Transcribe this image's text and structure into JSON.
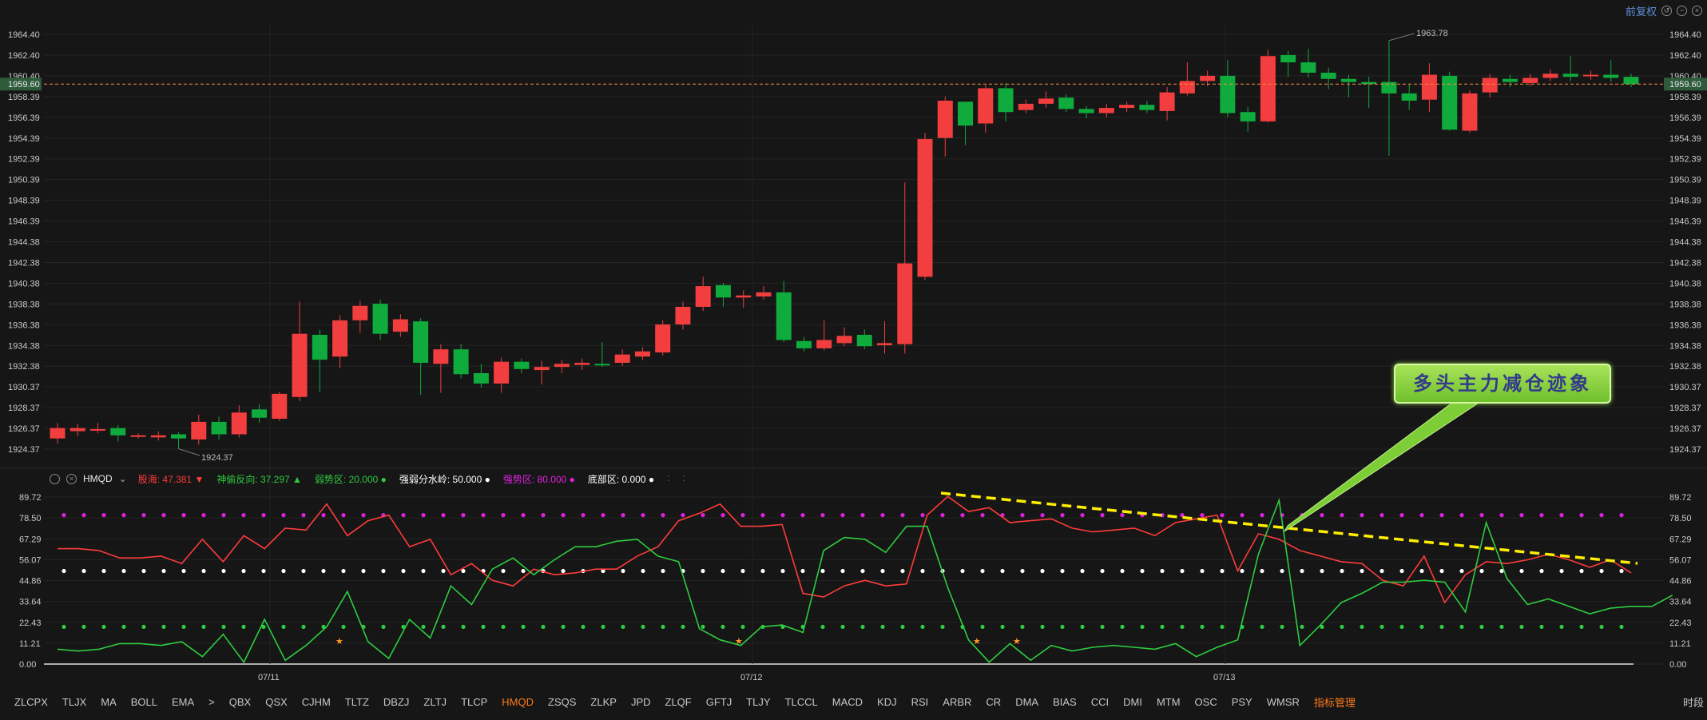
{
  "top_right": {
    "label": "前复权"
  },
  "main_chart": {
    "y_ticks": [
      "1964.40",
      "1962.40",
      "1960.40",
      "1958.39",
      "1956.39",
      "1954.39",
      "1952.39",
      "1950.39",
      "1948.39",
      "1946.39",
      "1944.38",
      "1942.38",
      "1940.38",
      "1938.38",
      "1936.38",
      "1934.38",
      "1932.38",
      "1930.37",
      "1928.37",
      "1926.37",
      "1924.37"
    ],
    "current_price": "1959.60",
    "max_label": "1963.78",
    "min_label": "1924.37"
  },
  "chart_data": [
    {
      "type": "candlestick",
      "title": "",
      "ylim": [
        1922.8,
        1965.6
      ],
      "x_labels": [
        "07/11",
        "07/12",
        "07/13"
      ],
      "candles": [
        {
          "o": 1925.4,
          "c": 1926.4,
          "h": 1926.9,
          "l": 1924.9
        },
        {
          "o": 1926.1,
          "c": 1926.4,
          "h": 1926.8,
          "l": 1925.6
        },
        {
          "o": 1926.2,
          "c": 1926.3,
          "h": 1926.9,
          "l": 1925.9
        },
        {
          "o": 1926.4,
          "c": 1925.7,
          "h": 1926.7,
          "l": 1925.1
        },
        {
          "o": 1925.6,
          "c": 1925.7,
          "h": 1925.9,
          "l": 1925.4
        },
        {
          "o": 1925.5,
          "c": 1925.7,
          "h": 1926.1,
          "l": 1925.2
        },
        {
          "o": 1925.8,
          "c": 1925.4,
          "h": 1926.0,
          "l": 1924.4
        },
        {
          "o": 1925.3,
          "c": 1927.0,
          "h": 1927.7,
          "l": 1924.8
        },
        {
          "o": 1927.0,
          "c": 1925.8,
          "h": 1927.5,
          "l": 1925.3
        },
        {
          "o": 1925.8,
          "c": 1927.9,
          "h": 1928.6,
          "l": 1925.5
        },
        {
          "o": 1928.2,
          "c": 1927.4,
          "h": 1928.7,
          "l": 1926.9
        },
        {
          "o": 1927.3,
          "c": 1929.7,
          "h": 1929.9,
          "l": 1927.1
        },
        {
          "o": 1929.4,
          "c": 1935.5,
          "h": 1938.6,
          "l": 1929.0
        },
        {
          "o": 1935.4,
          "c": 1933.0,
          "h": 1935.9,
          "l": 1929.9
        },
        {
          "o": 1933.3,
          "c": 1936.8,
          "h": 1937.3,
          "l": 1932.2
        },
        {
          "o": 1936.8,
          "c": 1938.2,
          "h": 1938.7,
          "l": 1935.6
        },
        {
          "o": 1938.4,
          "c": 1935.5,
          "h": 1938.8,
          "l": 1934.9
        },
        {
          "o": 1935.7,
          "c": 1936.9,
          "h": 1937.4,
          "l": 1935.2
        },
        {
          "o": 1936.7,
          "c": 1932.7,
          "h": 1937.0,
          "l": 1929.6
        },
        {
          "o": 1932.6,
          "c": 1934.0,
          "h": 1934.5,
          "l": 1929.8
        },
        {
          "o": 1934.0,
          "c": 1931.6,
          "h": 1934.5,
          "l": 1931.2
        },
        {
          "o": 1931.7,
          "c": 1930.7,
          "h": 1932.6,
          "l": 1930.3
        },
        {
          "o": 1930.7,
          "c": 1932.8,
          "h": 1933.2,
          "l": 1929.8
        },
        {
          "o": 1932.8,
          "c": 1932.1,
          "h": 1933.1,
          "l": 1931.7
        },
        {
          "o": 1932.0,
          "c": 1932.3,
          "h": 1932.9,
          "l": 1930.6
        },
        {
          "o": 1932.3,
          "c": 1932.6,
          "h": 1933.0,
          "l": 1931.7
        },
        {
          "o": 1932.5,
          "c": 1932.7,
          "h": 1933.1,
          "l": 1932.0
        },
        {
          "o": 1932.6,
          "c": 1932.5,
          "h": 1934.7,
          "l": 1932.3
        },
        {
          "o": 1932.7,
          "c": 1933.5,
          "h": 1934.0,
          "l": 1932.4
        },
        {
          "o": 1933.3,
          "c": 1933.8,
          "h": 1934.2,
          "l": 1933.0
        },
        {
          "o": 1933.7,
          "c": 1936.4,
          "h": 1936.8,
          "l": 1933.4
        },
        {
          "o": 1936.4,
          "c": 1938.1,
          "h": 1938.6,
          "l": 1935.9
        },
        {
          "o": 1938.1,
          "c": 1940.1,
          "h": 1941.0,
          "l": 1937.7
        },
        {
          "o": 1940.2,
          "c": 1939.0,
          "h": 1940.4,
          "l": 1938.1
        },
        {
          "o": 1939.0,
          "c": 1939.2,
          "h": 1939.7,
          "l": 1938.0
        },
        {
          "o": 1939.1,
          "c": 1939.5,
          "h": 1940.1,
          "l": 1938.8
        },
        {
          "o": 1939.5,
          "c": 1934.9,
          "h": 1940.6,
          "l": 1934.7
        },
        {
          "o": 1934.8,
          "c": 1934.1,
          "h": 1935.2,
          "l": 1933.8
        },
        {
          "o": 1934.1,
          "c": 1934.9,
          "h": 1936.8,
          "l": 1933.9
        },
        {
          "o": 1934.6,
          "c": 1935.3,
          "h": 1936.1,
          "l": 1934.3
        },
        {
          "o": 1935.4,
          "c": 1934.3,
          "h": 1935.9,
          "l": 1934.0
        },
        {
          "o": 1934.4,
          "c": 1934.6,
          "h": 1936.7,
          "l": 1933.6
        },
        {
          "o": 1934.5,
          "c": 1942.3,
          "h": 1950.1,
          "l": 1933.6
        },
        {
          "o": 1941.0,
          "c": 1954.3,
          "h": 1954.9,
          "l": 1940.7
        },
        {
          "o": 1954.4,
          "c": 1958.0,
          "h": 1958.4,
          "l": 1952.6
        },
        {
          "o": 1957.9,
          "c": 1955.6,
          "h": 1957.6,
          "l": 1953.7
        },
        {
          "o": 1955.8,
          "c": 1959.2,
          "h": 1959.5,
          "l": 1954.9
        },
        {
          "o": 1959.2,
          "c": 1956.9,
          "h": 1959.7,
          "l": 1956.0
        },
        {
          "o": 1957.1,
          "c": 1957.7,
          "h": 1958.1,
          "l": 1956.8
        },
        {
          "o": 1957.7,
          "c": 1958.2,
          "h": 1958.9,
          "l": 1957.3
        },
        {
          "o": 1958.3,
          "c": 1957.2,
          "h": 1958.6,
          "l": 1956.9
        },
        {
          "o": 1957.2,
          "c": 1956.8,
          "h": 1957.5,
          "l": 1956.3
        },
        {
          "o": 1956.8,
          "c": 1957.3,
          "h": 1957.7,
          "l": 1956.4
        },
        {
          "o": 1957.3,
          "c": 1957.6,
          "h": 1957.9,
          "l": 1956.9
        },
        {
          "o": 1957.6,
          "c": 1957.1,
          "h": 1958.0,
          "l": 1956.8
        },
        {
          "o": 1957.0,
          "c": 1958.8,
          "h": 1959.3,
          "l": 1956.1
        },
        {
          "o": 1958.7,
          "c": 1959.9,
          "h": 1961.7,
          "l": 1958.5
        },
        {
          "o": 1959.9,
          "c": 1960.4,
          "h": 1960.9,
          "l": 1959.4
        },
        {
          "o": 1960.4,
          "c": 1956.8,
          "h": 1961.9,
          "l": 1956.4
        },
        {
          "o": 1956.9,
          "c": 1956.0,
          "h": 1957.4,
          "l": 1955.0
        },
        {
          "o": 1956.0,
          "c": 1962.3,
          "h": 1962.9,
          "l": 1955.9
        },
        {
          "o": 1962.4,
          "c": 1961.7,
          "h": 1962.8,
          "l": 1960.3
        },
        {
          "o": 1961.7,
          "c": 1960.7,
          "h": 1963.0,
          "l": 1960.2
        },
        {
          "o": 1960.7,
          "c": 1960.1,
          "h": 1961.2,
          "l": 1959.1
        },
        {
          "o": 1960.1,
          "c": 1959.8,
          "h": 1960.5,
          "l": 1958.3
        },
        {
          "o": 1959.8,
          "c": 1959.6,
          "h": 1960.3,
          "l": 1957.3
        },
        {
          "o": 1959.8,
          "c": 1958.7,
          "h": 1963.8,
          "l": 1952.7
        },
        {
          "o": 1958.7,
          "c": 1958.0,
          "h": 1959.6,
          "l": 1957.1
        },
        {
          "o": 1958.1,
          "c": 1960.5,
          "h": 1961.6,
          "l": 1956.9
        },
        {
          "o": 1960.4,
          "c": 1955.2,
          "h": 1960.8,
          "l": 1955.1
        },
        {
          "o": 1955.1,
          "c": 1958.7,
          "h": 1959.0,
          "l": 1954.9
        },
        {
          "o": 1958.8,
          "c": 1960.2,
          "h": 1960.6,
          "l": 1958.3
        },
        {
          "o": 1960.1,
          "c": 1959.8,
          "h": 1960.5,
          "l": 1959.3
        },
        {
          "o": 1959.7,
          "c": 1960.2,
          "h": 1960.6,
          "l": 1959.4
        },
        {
          "o": 1960.2,
          "c": 1960.6,
          "h": 1961.0,
          "l": 1959.9
        },
        {
          "o": 1960.6,
          "c": 1960.3,
          "h": 1962.3,
          "l": 1959.9
        },
        {
          "o": 1960.4,
          "c": 1960.5,
          "h": 1960.9,
          "l": 1960.0
        },
        {
          "o": 1960.5,
          "c": 1960.2,
          "h": 1961.9,
          "l": 1959.8
        },
        {
          "o": 1960.3,
          "c": 1959.6,
          "h": 1960.6,
          "l": 1959.3
        }
      ]
    },
    {
      "type": "line",
      "title": "HMQD",
      "ylim": [
        0,
        89.72
      ],
      "y_ticks": [
        "89.72",
        "78.50",
        "67.29",
        "56.07",
        "44.86",
        "33.64",
        "22.43",
        "11.21",
        "0.00"
      ],
      "x_labels": [
        "07/11",
        "07/12",
        "07/13"
      ],
      "series": [
        {
          "name": "股海",
          "color": "#ff3b3b",
          "values": [
            62,
            62,
            61,
            57,
            57,
            58,
            54,
            67,
            55,
            69,
            62,
            73,
            72,
            86,
            69,
            77,
            80,
            63,
            67,
            48,
            54,
            45,
            42,
            51,
            48,
            49,
            51,
            51,
            58,
            63,
            77,
            81,
            86,
            74,
            74,
            75,
            38,
            36,
            42,
            45,
            42,
            43,
            80,
            90,
            82,
            84,
            76,
            77,
            78,
            73,
            71,
            72,
            73,
            69,
            76,
            78,
            80,
            50,
            70,
            67,
            61,
            58,
            55,
            54,
            45,
            42,
            58,
            33,
            48,
            55,
            54,
            56,
            59,
            56,
            52,
            56,
            49
          ]
        },
        {
          "name": "神偷反向",
          "color": "#2ecc40",
          "values": [
            8,
            7,
            8,
            11,
            11,
            10,
            12,
            4,
            16,
            1,
            24,
            2,
            10,
            20,
            39,
            12,
            3,
            24,
            14,
            42,
            32,
            51,
            57,
            48,
            56,
            63,
            63,
            66,
            67,
            58,
            55,
            19,
            13,
            10,
            20,
            21,
            17,
            61,
            68,
            67,
            60,
            74,
            74,
            41,
            13,
            1,
            11,
            2,
            10,
            7,
            9,
            10,
            9,
            8,
            11,
            4,
            9,
            13,
            59,
            88,
            10,
            21,
            33,
            38,
            44,
            44,
            45,
            44,
            28,
            76,
            46,
            32,
            35,
            31,
            27,
            30,
            31,
            31,
            37
          ]
        },
        {
          "name": "弱势区",
          "color": "#2ecc40",
          "values": [
            20.0
          ]
        },
        {
          "name": "强弱分水岭",
          "color": "#ffffff",
          "values": [
            50.0
          ]
        },
        {
          "name": "强势区",
          "color": "#e020e0",
          "values": [
            80.0
          ]
        },
        {
          "name": "底部区",
          "color": "#ffffff",
          "values": [
            0.0
          ]
        }
      ]
    }
  ],
  "indicator_bar": {
    "name": "HMQD",
    "items": [
      {
        "label": "股海:",
        "value": "47.381",
        "color": "#ff3b3b",
        "arrow": "▼"
      },
      {
        "label": "神偷反向:",
        "value": "37.297",
        "color": "#2ecc40",
        "arrow": "▲"
      },
      {
        "label": "弱势区:",
        "value": "20.000",
        "color": "#2ecc40",
        "arrow": "●"
      },
      {
        "label": "强弱分水岭:",
        "value": "50.000",
        "color": "#ffffff",
        "arrow": "●"
      },
      {
        "label": "强势区:",
        "value": "80.000",
        "color": "#e020e0",
        "arrow": "●"
      },
      {
        "label": "底部区:",
        "value": "0.000",
        "color": "#ffffff",
        "arrow": "●"
      }
    ]
  },
  "callout": {
    "text": "多头主力减仓迹象"
  },
  "bottom_tabs": [
    "ZLCPX",
    "TLJX",
    "MA",
    "BOLL",
    "EMA",
    ">",
    "QBX",
    "QSX",
    "CJHM",
    "TLTZ",
    "DBZJ",
    "ZLTJ",
    "TLCP",
    "HMQD",
    "ZSQS",
    "ZLKP",
    "JPD",
    "ZLQF",
    "GFTJ",
    "TLJY",
    "TLCCL",
    "MACD",
    "KDJ",
    "RSI",
    "ARBR",
    "CR",
    "DMA",
    "BIAS",
    "CCI",
    "DMI",
    "MTM",
    "OSC",
    "PSY",
    "WMSR"
  ],
  "active_tab": "HMQD",
  "manage_label": "指标管理",
  "right_label": "时段",
  "colors": {
    "up": "#f23e3e",
    "down": "#0fab3c",
    "background": "#161616",
    "price_line": "#ff8a3d",
    "trend": "#ffee00"
  }
}
